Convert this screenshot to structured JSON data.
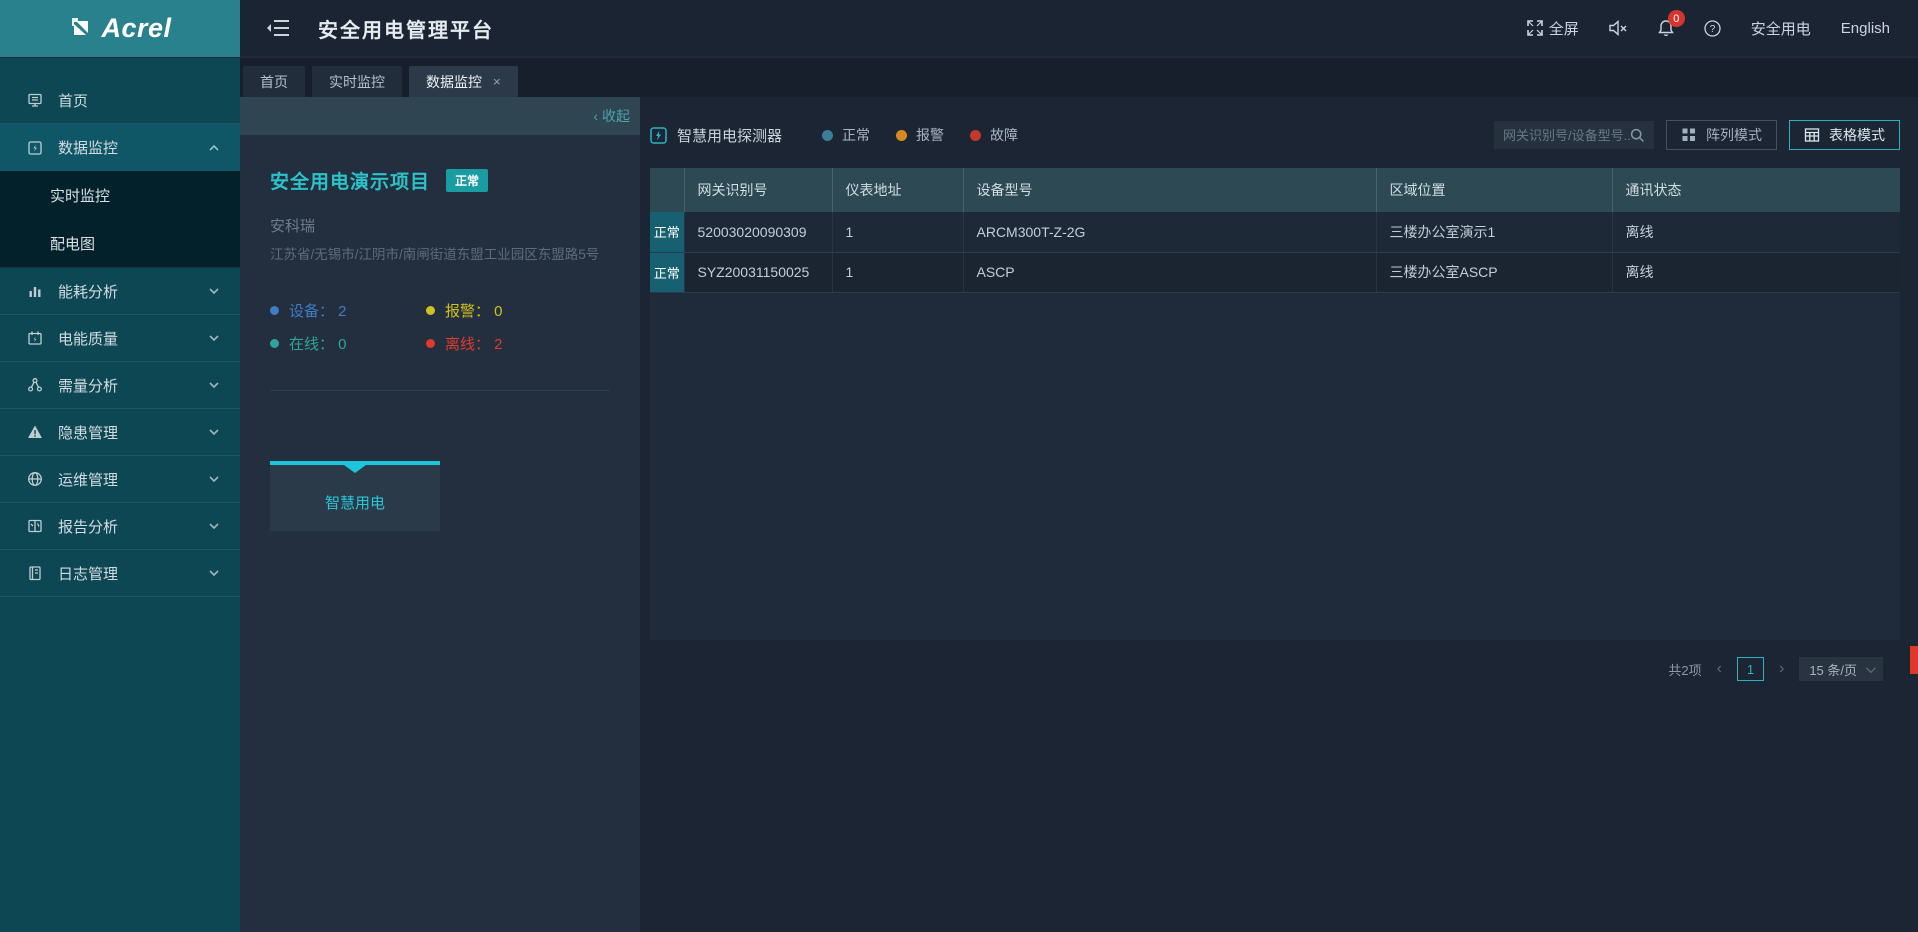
{
  "header": {
    "logo": "Acrel",
    "title": "安全用电管理平台",
    "fullscreen_label": "全屏",
    "notification_count": "0",
    "user_label": "安全用电",
    "language_label": "English"
  },
  "sidebar": {
    "items": [
      {
        "label": "首页",
        "icon": "home-icon",
        "chevron": "none",
        "active": false
      },
      {
        "label": "数据监控",
        "icon": "data-monitor-icon",
        "chevron": "up",
        "active": true,
        "children": [
          {
            "label": "实时监控"
          },
          {
            "label": "配电图"
          }
        ]
      },
      {
        "label": "能耗分析",
        "icon": "energy-analysis-icon",
        "chevron": "down",
        "active": false
      },
      {
        "label": "电能质量",
        "icon": "power-quality-icon",
        "chevron": "down",
        "active": false
      },
      {
        "label": "需量分析",
        "icon": "demand-analysis-icon",
        "chevron": "down",
        "active": false
      },
      {
        "label": "隐患管理",
        "icon": "hazard-management-icon",
        "chevron": "down",
        "active": false
      },
      {
        "label": "运维管理",
        "icon": "operations-icon",
        "chevron": "down",
        "active": false
      },
      {
        "label": "报告分析",
        "icon": "report-analysis-icon",
        "chevron": "down",
        "active": false
      },
      {
        "label": "日志管理",
        "icon": "log-management-icon",
        "chevron": "down",
        "active": false
      }
    ]
  },
  "tabs": [
    {
      "label": "首页",
      "active": false,
      "closable": false
    },
    {
      "label": "实时监控",
      "active": false,
      "closable": false
    },
    {
      "label": "数据监控",
      "active": true,
      "closable": true
    }
  ],
  "project_panel": {
    "collapse_label": "收起",
    "collapse_glyph": "‹",
    "title": "安全用电演示项目",
    "status_badge": "正常",
    "company": "安科瑞",
    "address": "江苏省/无锡市/江阴市/南闸街道东盟工业园区东盟路5号",
    "stats": [
      {
        "label": "设备：",
        "value": "2",
        "color": "#3f7dc4"
      },
      {
        "label": "报警：",
        "value": "0",
        "color": "#cfc11e"
      },
      {
        "label": "在线：",
        "value": "0",
        "color": "#2fa39c"
      },
      {
        "label": "离线：",
        "value": "2",
        "color": "#dd3b2e"
      }
    ],
    "category_card": {
      "label": "智慧用电"
    }
  },
  "main": {
    "section_title": "智慧用电探测器",
    "legend": [
      {
        "label": "正常",
        "color": "#3d7d99"
      },
      {
        "label": "报警",
        "color": "#d68a1e"
      },
      {
        "label": "故障",
        "color": "#c4392c"
      }
    ],
    "search_placeholder": "网关识别号/设备型号...",
    "mode_buttons": [
      {
        "label": "阵列模式",
        "icon": "grid-mode-icon",
        "active": false
      },
      {
        "label": "表格模式",
        "icon": "table-mode-icon",
        "active": true
      }
    ],
    "table": {
      "columns": [
        "",
        "网关识别号",
        "仪表地址",
        "设备型号",
        "区域位置",
        "通讯状态"
      ],
      "rows": [
        {
          "status": "正常",
          "cells": [
            "52003020090309",
            "1",
            "ARCM300T-Z-2G",
            "三楼办公室演示1",
            "离线"
          ]
        },
        {
          "status": "正常",
          "cells": [
            "SYZ20031150025",
            "1",
            "ASCP",
            "三楼办公室ASCP",
            "离线"
          ]
        }
      ]
    },
    "pagination": {
      "total": "共2项",
      "prev_glyph": "‹",
      "next_glyph": "›",
      "current_page": "1",
      "page_size": "15 条/页"
    }
  },
  "glyphs": {
    "tab_close": "×"
  }
}
